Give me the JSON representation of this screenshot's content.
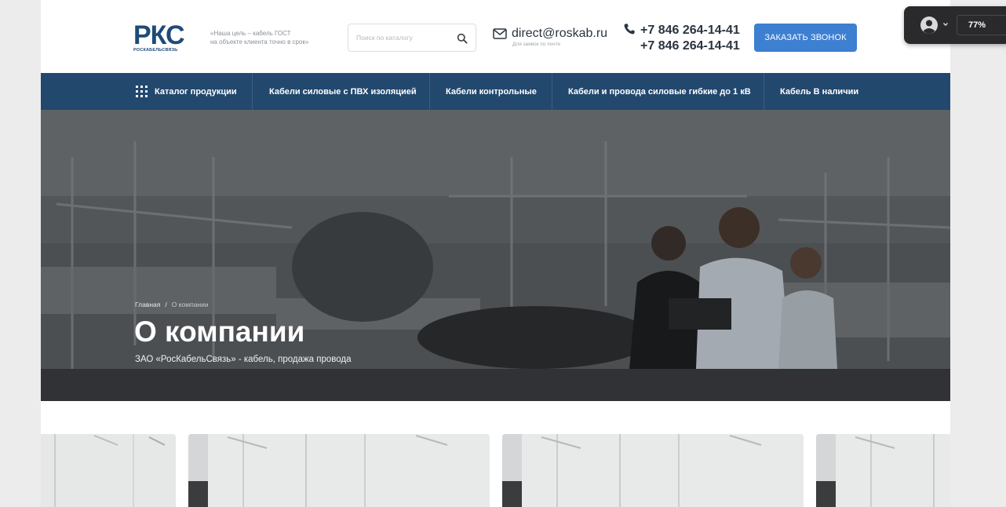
{
  "header": {
    "logo_text": "РКС",
    "logo_sub": "РОСКАБЕЛЬСВЯЗЬ",
    "tagline_line1": "«Наша цель – кабель ГОСТ",
    "tagline_line2": "на объекте клиента точно в срок»",
    "search_placeholder": "Поиск по каталогу",
    "email": "direct@roskab.ru",
    "email_note": "Для заявок по почте",
    "phone1": "+7 846 264-14-41",
    "phone2": "+7 846 264-14-41",
    "callback_label": "ЗАКАЗАТЬ ЗВОНОК"
  },
  "nav": {
    "catalog_label": "Каталог продукции",
    "items": [
      {
        "label": "Кабели силовые с ПВХ изоляцией"
      },
      {
        "label": "Кабели контрольные"
      },
      {
        "label": "Кабели и провода силовые гибкие до 1 кВ"
      },
      {
        "label": "Кабель В наличии"
      }
    ]
  },
  "hero": {
    "breadcrumb_home": "Главная",
    "breadcrumb_sep": "/",
    "breadcrumb_current": "О компании",
    "title": "О компании",
    "subtitle": "ЗАО «РосКабельСвязь» - кабель, продажа провода"
  },
  "widget": {
    "zoom": "77%"
  },
  "colors": {
    "brand": "#1f4a78",
    "nav_bg": "#22486e",
    "accent": "#3d7fd1"
  }
}
